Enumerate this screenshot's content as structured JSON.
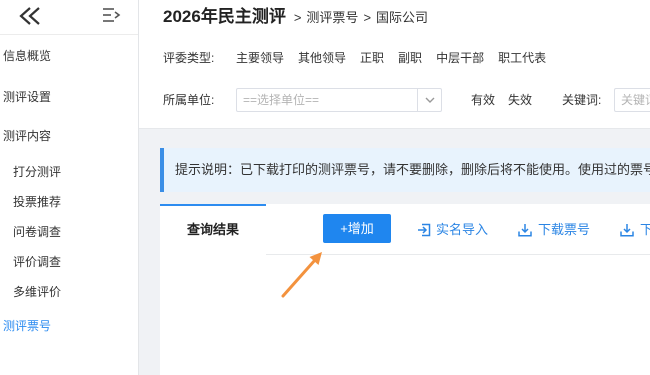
{
  "colors": {
    "accent": "#1f86ef",
    "link": "#2b85e4",
    "active": "#2d8cf0",
    "notice_bg": "#e8f3fd",
    "notice_border": "#3a8ee6",
    "annotation_arrow": "#f3923e"
  },
  "sidebar": {
    "collapse_icon": "double-chevron-left-icon",
    "menu_toggle_icon": "menu-fold-icon",
    "items": [
      {
        "label": "信息概览"
      },
      {
        "label": "测评设置"
      },
      {
        "label": "测评内容"
      },
      {
        "label": "打分测评"
      },
      {
        "label": "投票推荐"
      },
      {
        "label": "问卷调查"
      },
      {
        "label": "评价调查"
      },
      {
        "label": "多维评价"
      },
      {
        "label": "测评票号",
        "active": true
      }
    ]
  },
  "header": {
    "title": "2026年民主测评",
    "breadcrumb": [
      {
        "sep": ">",
        "label": "测评票号"
      },
      {
        "sep": ">",
        "label": "国际公司"
      }
    ]
  },
  "filters": {
    "judge_type": {
      "label": "评委类型:",
      "options": [
        "主要领导",
        "其他领导",
        "正职",
        "副职",
        "中层干部",
        "职工代表"
      ]
    },
    "unit": {
      "label": "所属单位:",
      "placeholder": "==选择单位==",
      "chevron_icon": "chevron-down-icon"
    },
    "status": {
      "options": [
        "有效",
        "失效"
      ]
    },
    "keyword": {
      "label": "关键词:",
      "placeholder": "关键词"
    }
  },
  "notice": {
    "text": "提示说明：已下载打印的测评票号，请不要删除，删除后将不能使用。使用过的票号"
  },
  "results": {
    "tab_label": "查询结果",
    "toolbar": {
      "add_label": "+增加",
      "import": {
        "label": "实名导入",
        "icon": "import-icon"
      },
      "download": {
        "label": "下载票号",
        "icon": "download-icon"
      },
      "more": {
        "label": "下",
        "icon": "download-icon"
      }
    }
  },
  "annotation": {
    "icon": "orange-arrow-icon"
  }
}
